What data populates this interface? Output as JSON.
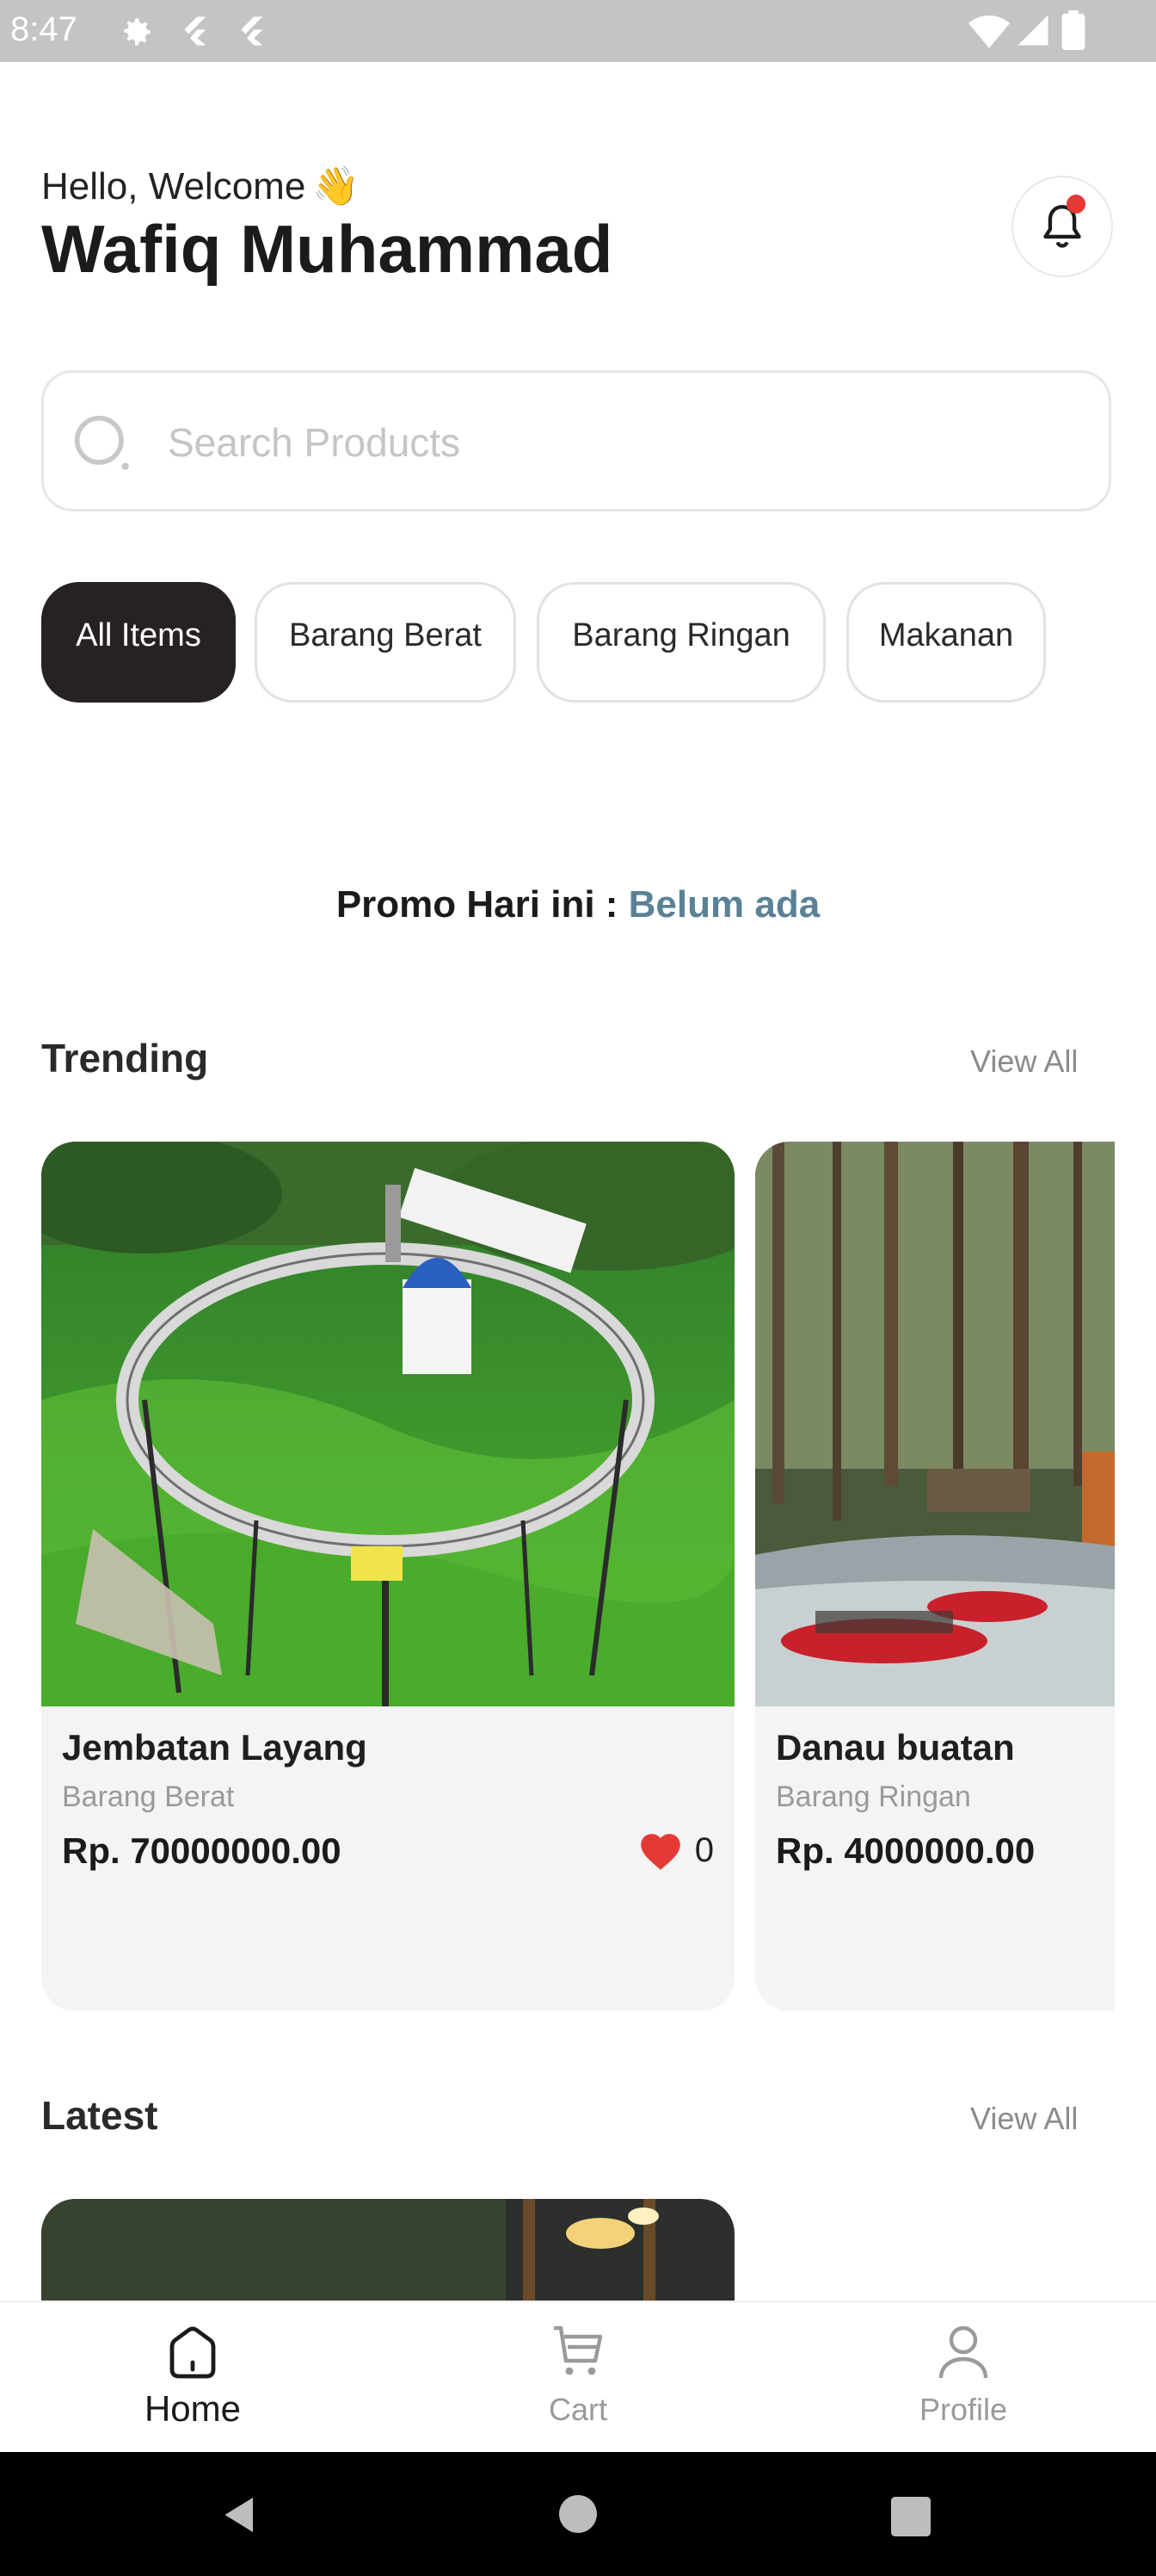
{
  "status_bar": {
    "time": "8:47",
    "icons": [
      "settings-icon",
      "flutter-icon",
      "flutter-icon",
      "wifi-icon",
      "signal-icon",
      "battery-icon"
    ]
  },
  "header": {
    "greeting": "Hello, Welcome",
    "greeting_emoji": "👋",
    "username": "Wafiq Muhammad",
    "notification_icon": "bell-icon"
  },
  "search": {
    "placeholder": "Search Products",
    "value": ""
  },
  "categories": [
    {
      "label": "All Items",
      "active": true
    },
    {
      "label": "Barang Berat",
      "active": false
    },
    {
      "label": "Barang Ringan",
      "active": false
    },
    {
      "label": "Makanan",
      "active": false
    }
  ],
  "promo": {
    "label": "Promo Hari ini :",
    "value": "Belum ada"
  },
  "trending": {
    "title": "Trending",
    "view_all": "View All",
    "items": [
      {
        "name": "Jembatan Layang",
        "category": "Barang Berat",
        "price": "Rp. 70000000.00",
        "likes": "0"
      },
      {
        "name": "Danau buatan",
        "category": "Barang Ringan",
        "price": "Rp. 4000000.00"
      }
    ]
  },
  "latest": {
    "title": "Latest",
    "view_all": "View All"
  },
  "bottom_nav": [
    {
      "label": "Home",
      "icon": "home-icon",
      "active": true
    },
    {
      "label": "Cart",
      "icon": "cart-icon",
      "active": false
    },
    {
      "label": "Profile",
      "icon": "profile-icon",
      "active": false
    }
  ],
  "colors": {
    "accent_dark": "#272222",
    "promo_value": "#5a8196",
    "like_heart": "#e53935",
    "notification_dot": "#e53935",
    "status_bar_bg": "#c4c4c4"
  }
}
